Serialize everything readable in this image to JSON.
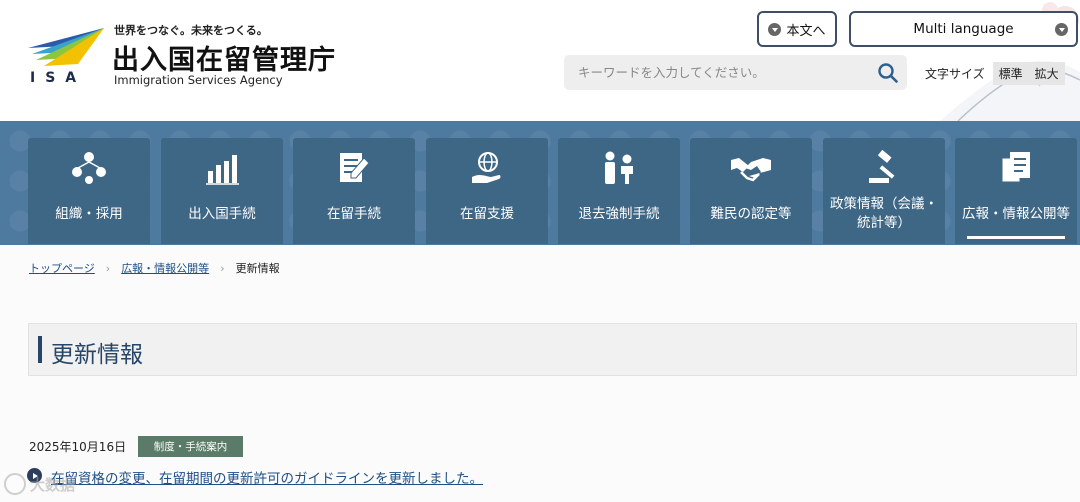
{
  "header": {
    "logo_mark_text": "ISA",
    "tagline": "世界をつなぐ。未来をつくる。",
    "agency_name_ja": "出入国在留管理庁",
    "agency_name_en": "Immigration Services Agency",
    "skip_button": "本文へ",
    "language_button": "Multi language",
    "search_placeholder": "キーワードを入力してください。",
    "font_size_label": "文字サイズ",
    "font_size_standard": "標準",
    "font_size_large": "拡大"
  },
  "nav": {
    "items": [
      {
        "label": "組織・採用",
        "icon": "organization-icon"
      },
      {
        "label": "出入国手続",
        "icon": "chart-bars-icon"
      },
      {
        "label": "在留手続",
        "icon": "document-pen-icon"
      },
      {
        "label": "在留支援",
        "icon": "globe-hand-icon"
      },
      {
        "label": "退去強制手続",
        "icon": "people-icon"
      },
      {
        "label": "難民の認定等",
        "icon": "handshake-icon"
      },
      {
        "label": "政策情報（会議・統計等）",
        "icon": "gavel-icon"
      },
      {
        "label": "広報・情報公開等",
        "icon": "documents-icon",
        "active": true
      }
    ]
  },
  "breadcrumb": {
    "home": "トップページ",
    "parent": "広報・情報公開等",
    "current": "更新情報"
  },
  "page": {
    "title": "更新情報"
  },
  "news": [
    {
      "date": "2025年10月16日",
      "category": "制度・手続案内",
      "title": "在留資格の変更、在留期間の更新許可のガイドラインを更新しました。"
    }
  ],
  "watermark": {
    "text": "大数据"
  },
  "colors": {
    "nav_bg": "#4f7aa0",
    "nav_item_bg": "#3e6685",
    "title_accent": "#274566",
    "link": "#1f4f86",
    "badge": "#5a7b67"
  }
}
